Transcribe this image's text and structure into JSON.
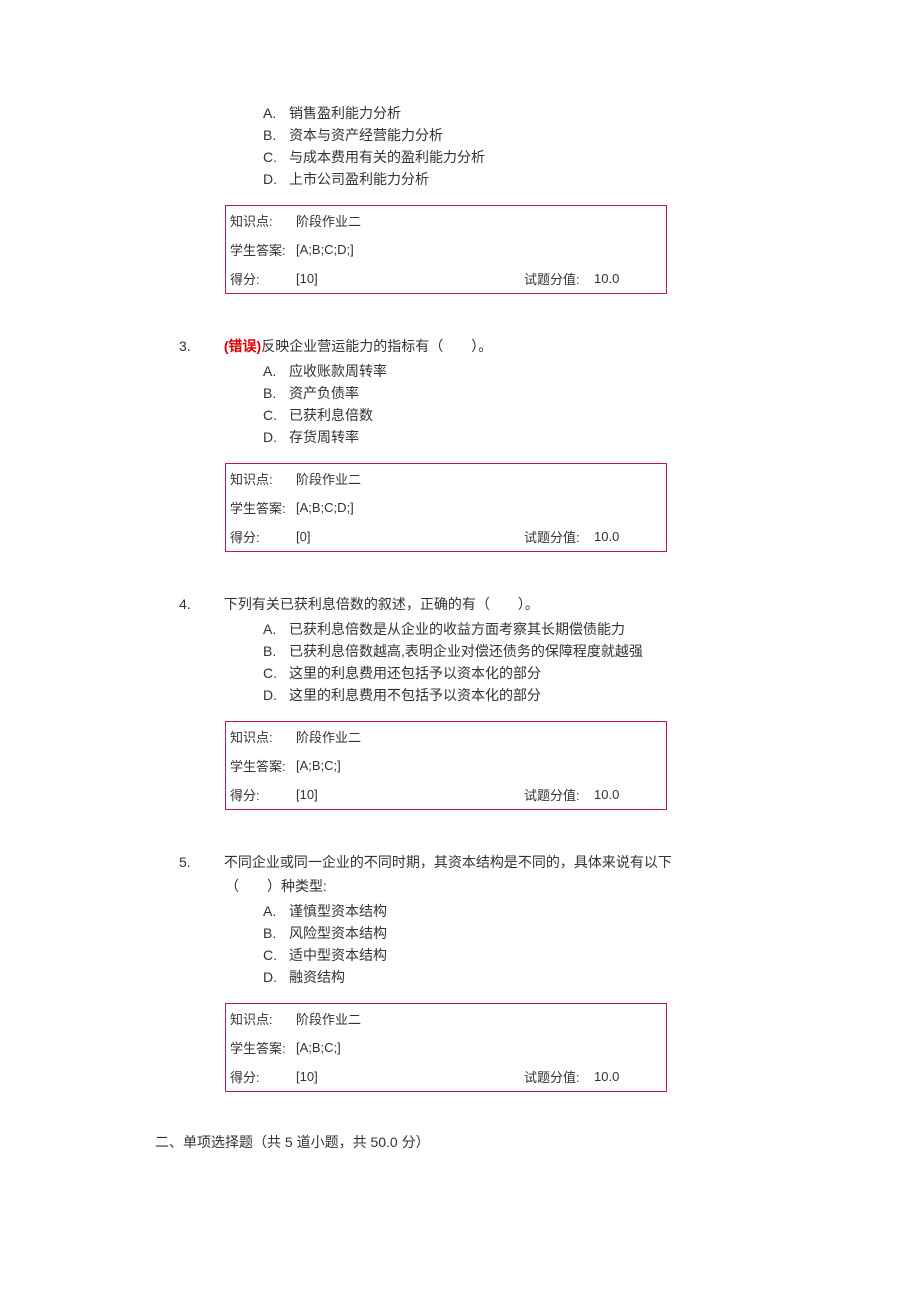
{
  "labels": {
    "knowledge": "知识点:",
    "student_answer": "学生答案:",
    "score": "得分:",
    "question_value": "试题分值:"
  },
  "questions": [
    {
      "number": "",
      "wrong_marker": "",
      "stem": "",
      "options": {
        "A": "销售盈利能力分析",
        "B": "资本与资产经营能力分析",
        "C": "与成本费用有关的盈利能力分析",
        "D": "上市公司盈利能力分析"
      },
      "knowledge": "阶段作业二",
      "student_answer": "[A;B;C;D;]",
      "score": "[10]",
      "question_value": "10.0"
    },
    {
      "number": "3.",
      "wrong_marker": "(错误)",
      "stem": "反映企业营运能力的指标有（　　）。",
      "options": {
        "A": "应收账款周转率",
        "B": "资产负债率",
        "C": "已获利息倍数",
        "D": "存货周转率"
      },
      "knowledge": "阶段作业二",
      "student_answer": "[A;B;C;D;]",
      "score": "[0]",
      "question_value": "10.0"
    },
    {
      "number": "4.",
      "wrong_marker": "",
      "stem": "下列有关已获利息倍数的叙述，正确的有（　　）。",
      "options": {
        "A": "已获利息倍数是从企业的收益方面考察其长期偿债能力",
        "B": "已获利息倍数越高,表明企业对偿还债务的保障程度就越强",
        "C": "这里的利息费用还包括予以资本化的部分",
        "D": "这里的利息费用不包括予以资本化的部分"
      },
      "knowledge": "阶段作业二",
      "student_answer": "[A;B;C;]",
      "score": "[10]",
      "question_value": "10.0"
    },
    {
      "number": "5.",
      "wrong_marker": "",
      "stem": "不同企业或同一企业的不同时期，其资本结构是不同的，具体来说有以下（　　）种类型:",
      "options": {
        "A": "谨慎型资本结构",
        "B": "风险型资本结构",
        "C": "适中型资本结构",
        "D": "融资结构"
      },
      "knowledge": "阶段作业二",
      "student_answer": "[A;B;C;]",
      "score": "[10]",
      "question_value": "10.0"
    }
  ],
  "section2": "二、单项选择题（共 5 道小题，共 50.0 分）"
}
